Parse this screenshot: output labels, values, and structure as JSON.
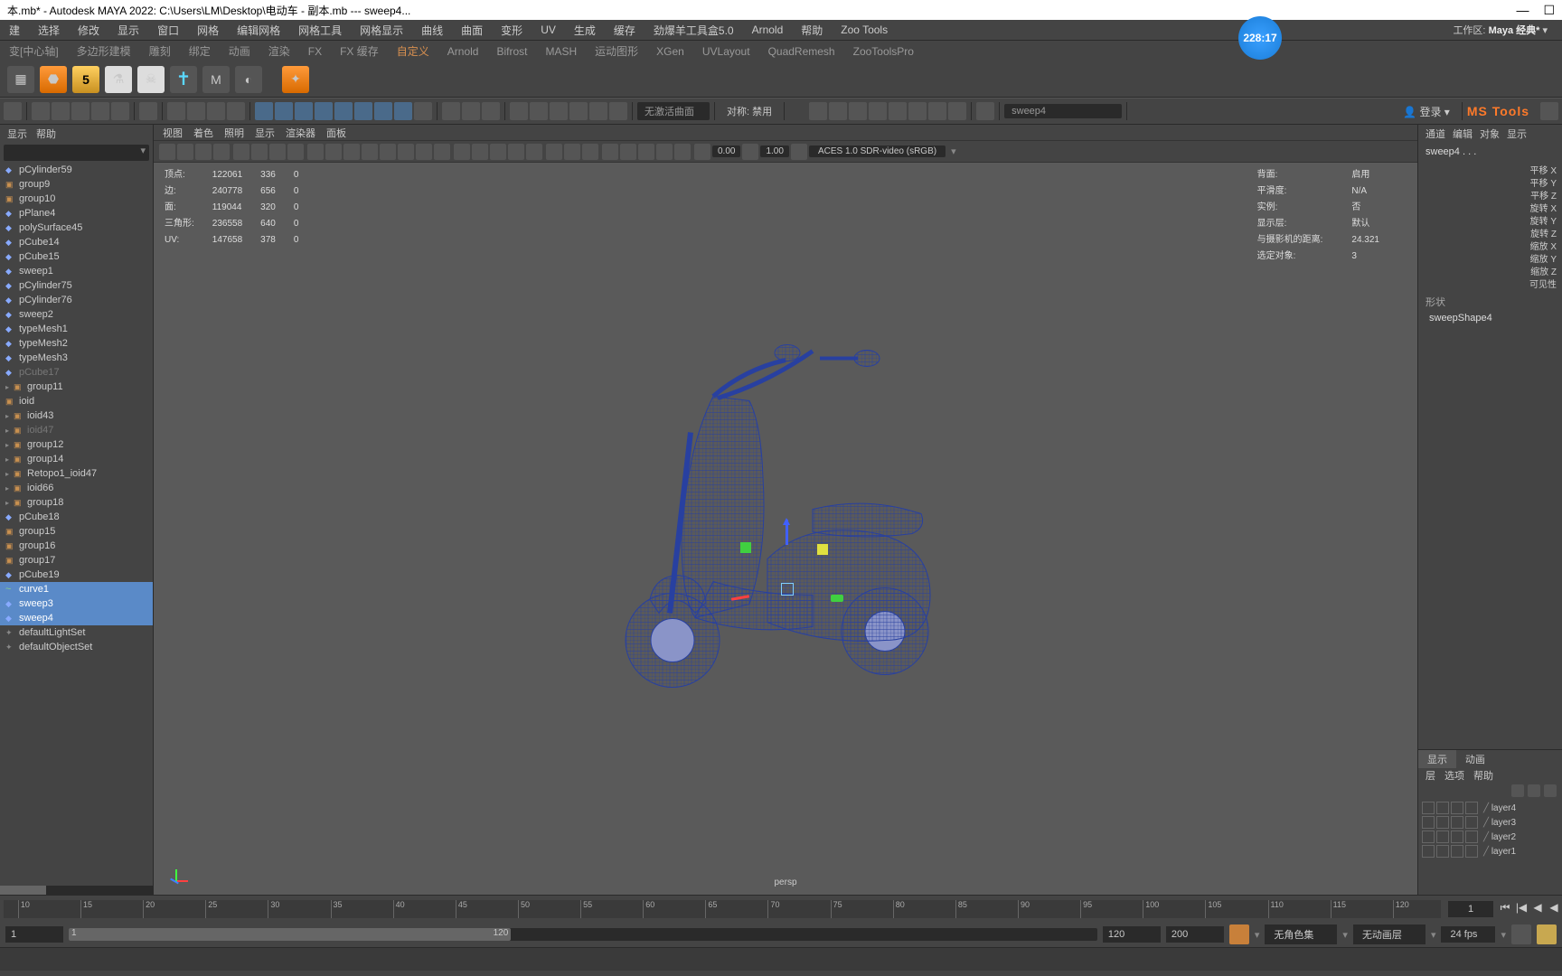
{
  "title": "本.mb* - Autodesk MAYA 2022: C:\\Users\\LM\\Desktop\\电动车 - 副本.mb  ---  sweep4...",
  "timer": "228:17",
  "workspace_label": "工作区:",
  "workspace_value": "Maya 经典*",
  "menu": [
    "建",
    "选择",
    "修改",
    "显示",
    "窗口",
    "网格",
    "编辑网格",
    "网格工具",
    "网格显示",
    "曲线",
    "曲面",
    "变形",
    "UV",
    "生成",
    "缓存",
    "劲爆羊工具盒5.0",
    "Arnold",
    "帮助",
    "Zoo Tools"
  ],
  "shelf_tabs": [
    "变[中心轴]",
    "多边形建模",
    "雕刻",
    "绑定",
    "动画",
    "渲染",
    "FX",
    "FX 缓存",
    "自定义",
    "Arnold",
    "Bifrost",
    "MASH",
    "运动图形",
    "XGen",
    "UVLayout",
    "QuadRemesh",
    "ZooToolsPro"
  ],
  "shelf_active": "自定义",
  "toolbar": {
    "curve_field": "无激活曲面",
    "sym_label": "对称: 禁用",
    "obj_field": "sweep4",
    "login": "登录",
    "mstools": "MS Tools"
  },
  "outliner": {
    "head": [
      "显示",
      "帮助"
    ],
    "items": [
      {
        "n": "pCylinder59",
        "t": "m"
      },
      {
        "n": "group9",
        "t": "g"
      },
      {
        "n": "group10",
        "t": "g"
      },
      {
        "n": "pPlane4",
        "t": "m"
      },
      {
        "n": "polySurface45",
        "t": "m"
      },
      {
        "n": "pCube14",
        "t": "m"
      },
      {
        "n": "pCube15",
        "t": "m"
      },
      {
        "n": "sweep1",
        "t": "m"
      },
      {
        "n": "pCylinder75",
        "t": "m"
      },
      {
        "n": "pCylinder76",
        "t": "m"
      },
      {
        "n": "sweep2",
        "t": "m"
      },
      {
        "n": "typeMesh1",
        "t": "m"
      },
      {
        "n": "typeMesh2",
        "t": "m"
      },
      {
        "n": "typeMesh3",
        "t": "m"
      },
      {
        "n": "pCube17",
        "t": "m",
        "dim": true
      },
      {
        "n": "group11",
        "t": "g",
        "a": true
      },
      {
        "n": "ioid",
        "t": "g"
      },
      {
        "n": "ioid43",
        "t": "g",
        "a": true
      },
      {
        "n": "ioid47",
        "t": "g",
        "dim": true,
        "a": true
      },
      {
        "n": "group12",
        "t": "g",
        "a": true
      },
      {
        "n": "group14",
        "t": "g",
        "a": true
      },
      {
        "n": "Retopo1_ioid47",
        "t": "g",
        "a": true
      },
      {
        "n": "ioid66",
        "t": "g",
        "a": true
      },
      {
        "n": "group18",
        "t": "g",
        "a": true
      },
      {
        "n": "pCube18",
        "t": "m"
      },
      {
        "n": "group15",
        "t": "g"
      },
      {
        "n": "group16",
        "t": "g"
      },
      {
        "n": "group17",
        "t": "g"
      },
      {
        "n": "pCube19",
        "t": "m"
      },
      {
        "n": "curve1",
        "t": "c",
        "sel": true
      },
      {
        "n": "sweep3",
        "t": "m",
        "sel": true
      },
      {
        "n": "sweep4",
        "t": "m",
        "sel": true
      },
      {
        "n": "defaultLightSet",
        "t": "l"
      },
      {
        "n": "defaultObjectSet",
        "t": "l"
      }
    ]
  },
  "viewport": {
    "menu": [
      "视图",
      "着色",
      "照明",
      "显示",
      "渲染器",
      "面板"
    ],
    "num1": "0.00",
    "num2": "1.00",
    "colorspace": "ACES 1.0 SDR-video (sRGB)",
    "persp": "persp",
    "stats": [
      [
        "顶点:",
        "122061",
        "336",
        "0"
      ],
      [
        "边:",
        "240778",
        "656",
        "0"
      ],
      [
        "面:",
        "119044",
        "320",
        "0"
      ],
      [
        "三角形:",
        "236558",
        "640",
        "0"
      ],
      [
        "UV:",
        "147658",
        "378",
        "0"
      ]
    ],
    "stats_r": [
      [
        "背面:",
        "启用"
      ],
      [
        "平滑度:",
        "N/A"
      ],
      [
        "实例:",
        "否"
      ],
      [
        "显示层:",
        "默认"
      ],
      [
        "与摄影机的距离:",
        "24.321"
      ],
      [
        "选定对象:",
        "3"
      ]
    ]
  },
  "channel": {
    "tabs": [
      "通道",
      "编辑",
      "对象",
      "显示"
    ],
    "obj": "sweep4 . . .",
    "attrs": [
      "平移 X",
      "平移 Y",
      "平移 Z",
      "旋转 X",
      "旋转 Y",
      "旋转 Z",
      "缩放 X",
      "缩放 Y",
      "缩放 Z",
      "可见性"
    ],
    "shape_h": "形状",
    "shape": "sweepShape4"
  },
  "layers": {
    "tabs": [
      "显示",
      "动画"
    ],
    "menu": [
      "层",
      "选项",
      "帮助"
    ],
    "items": [
      "layer4",
      "layer3",
      "layer2",
      "layer1"
    ]
  },
  "timeline": {
    "ticks": [
      10,
      15,
      20,
      25,
      30,
      35,
      40,
      45,
      50,
      55,
      60,
      65,
      70,
      75,
      80,
      85,
      90,
      95,
      100,
      105,
      110,
      115,
      120
    ],
    "current": "1"
  },
  "range": {
    "start": "1",
    "slide_start": "1",
    "slide_end": "120",
    "end1": "120",
    "end2": "200",
    "charset": "无角色集",
    "animlayer": "无动画层",
    "fps": "24 fps"
  }
}
